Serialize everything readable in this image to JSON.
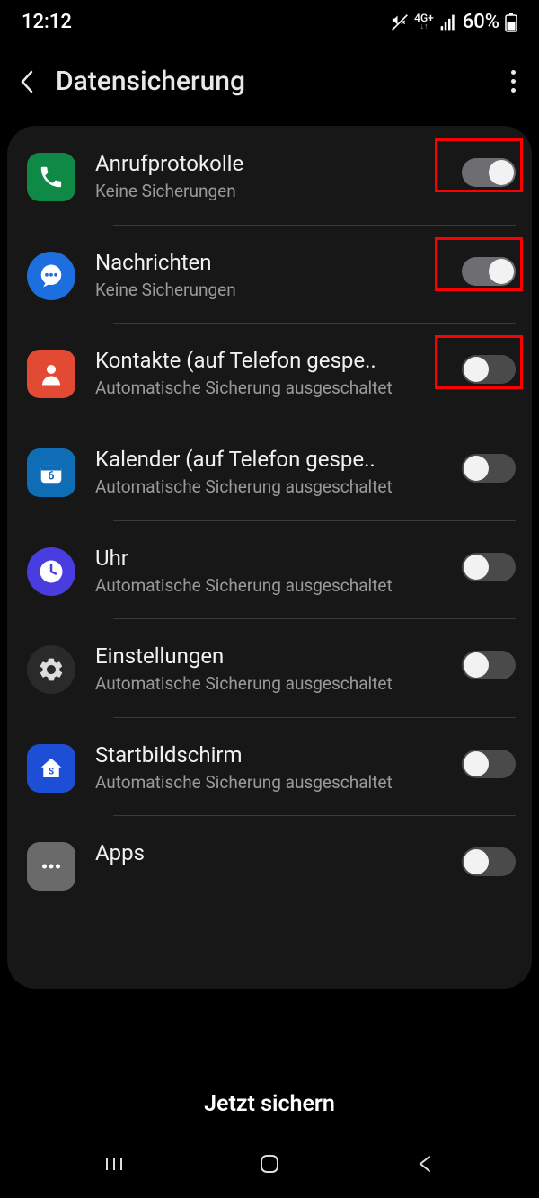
{
  "status": {
    "time": "12:12",
    "network_lbl": "4G+",
    "battery": "60%"
  },
  "header": {
    "title": "Datensicherung"
  },
  "items": [
    {
      "title": "Anrufprotokolle",
      "sub": "Keine Sicherungen",
      "icon": "phone",
      "bg": "#0f8a46",
      "shape": "squircle",
      "on": true,
      "hl": true
    },
    {
      "title": "Nachrichten",
      "sub": "Keine Sicherungen",
      "icon": "chat",
      "bg": "#1d6fe0",
      "shape": "round",
      "on": true,
      "hl": true
    },
    {
      "title": "Kontakte (auf Telefon gespe..",
      "sub": "Automatische Sicherung ausgeschaltet",
      "icon": "person",
      "bg": "#e24a33",
      "shape": "squircle",
      "on": false,
      "hl": true
    },
    {
      "title": "Kalender (auf Telefon gespe..",
      "sub": "Automatische Sicherung ausgeschaltet",
      "icon": "calendar",
      "bg": "#0e6db5",
      "shape": "squircle",
      "on": false,
      "hl": false
    },
    {
      "title": "Uhr",
      "sub": "Automatische Sicherung ausgeschaltet",
      "icon": "clock",
      "bg": "#4a3de0",
      "shape": "round",
      "on": false,
      "hl": false
    },
    {
      "title": "Einstellungen",
      "sub": "Automatische Sicherung ausgeschaltet",
      "icon": "gear",
      "bg": "#2a2a2a",
      "shape": "round",
      "on": false,
      "hl": false
    },
    {
      "title": "Startbildschirm",
      "sub": "Automatische Sicherung ausgeschaltet",
      "icon": "home",
      "bg": "#1d4fd6",
      "shape": "squircle",
      "on": false,
      "hl": false
    },
    {
      "title": "Apps",
      "sub": "",
      "icon": "dots",
      "bg": "#6a6a6a",
      "shape": "squircle",
      "on": false,
      "hl": false
    }
  ],
  "action": {
    "label": "Jetzt sichern"
  }
}
